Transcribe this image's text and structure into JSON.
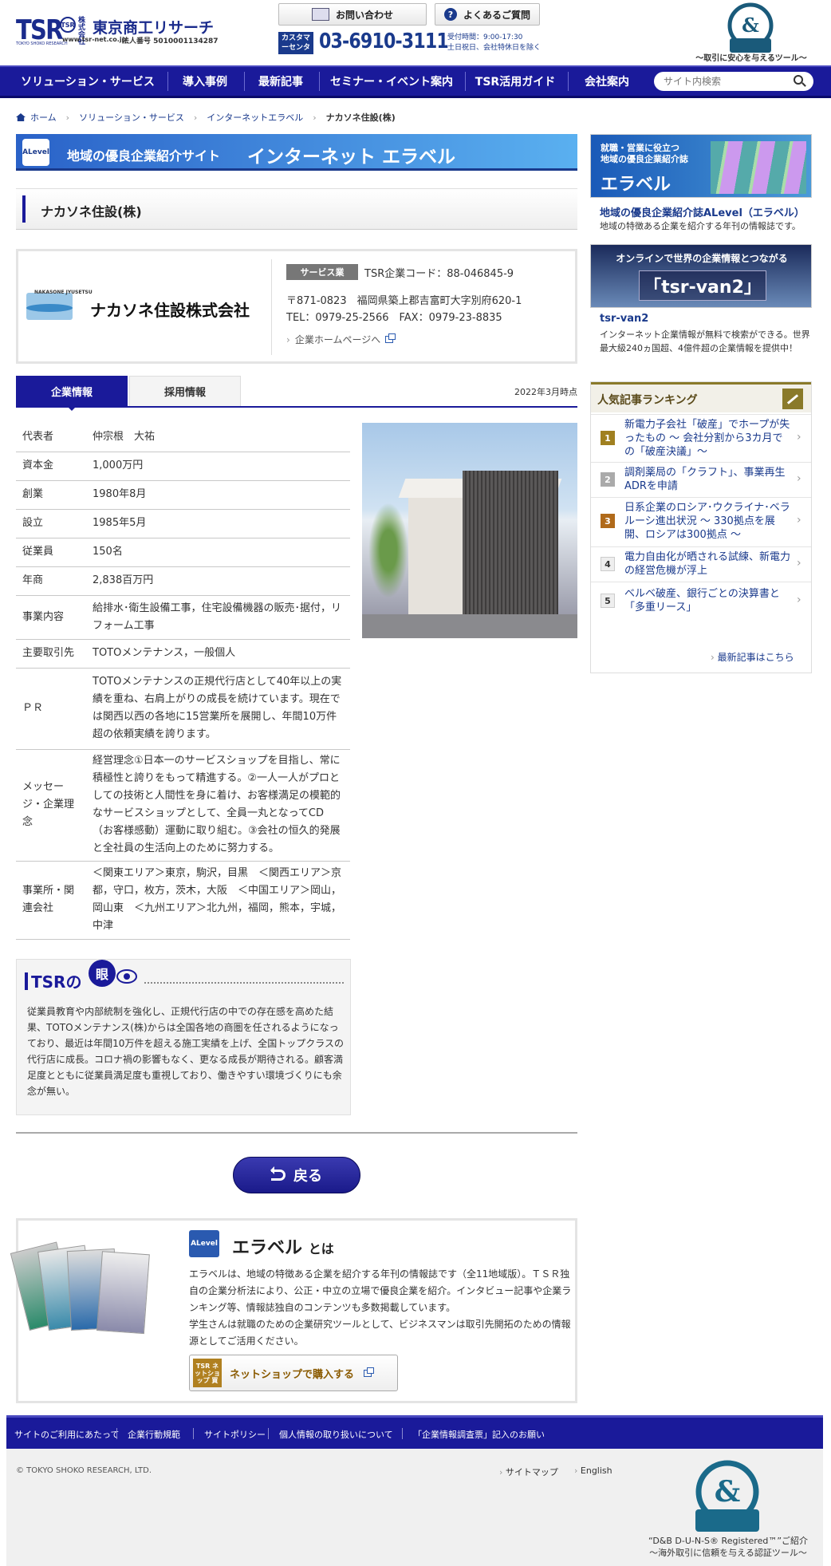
{
  "header": {
    "logo_tsr": "TSR",
    "logo_tsr_sub": "TOKYO SHOKO RESEARCH",
    "logo_mark": "TSR",
    "logo_kabushiki": "株式会社",
    "logo_name": "東京商工リサーチ",
    "logo_url": "www.tsr-net.co.jp",
    "corp_number": "法人番号 5010001134287",
    "contact_label": "お問い合わせ",
    "faq_label": "よくあるご質問",
    "cc_label": "カスタマーセンター",
    "cc_tel": "03-6910-3111",
    "cc_hours": "受付時間：9:00-17:30",
    "cc_closed": "土日祝日、会社特休日を除く",
    "duns_tagline": "〜取引に安心を与えるツール〜"
  },
  "nav": {
    "items": [
      "ソリューション・サービス",
      "導入事例",
      "最新記事",
      "セミナー・イベント案内",
      "TSR活用ガイド",
      "会社案内"
    ],
    "search_placeholder": "サイト内検索"
  },
  "breadcrumb": [
    "ホーム",
    "ソリューション・サービス",
    "インターネットエラベル",
    "ナカソネ住設(株)"
  ],
  "banner": {
    "logo": "ALevel",
    "t1": "地域の優良企業紹介サイト",
    "t2": "インターネット エラベル"
  },
  "company_title": "ナカソネ住設(株)",
  "card": {
    "logo_text": "NAKASONE JYUSETSU",
    "name": "ナカソネ住設株式会社",
    "service": "サービス業",
    "tsr_code": "TSR企業コード：88-046845-9",
    "address": "〒871-0823　福岡県築上郡吉富町大字別府620-1",
    "tel": "TEL：0979-25-2566　FAX：0979-23-8835",
    "homepage": "企業ホームページへ"
  },
  "tabs": {
    "active": "企業情報",
    "other": "採用情報",
    "as_of": "2022年3月時点"
  },
  "info_rows": [
    {
      "k": "代表者",
      "v": "仲宗根　大祐"
    },
    {
      "k": "資本金",
      "v": "1,000万円"
    },
    {
      "k": "創業",
      "v": "1980年8月"
    },
    {
      "k": "設立",
      "v": "1985年5月"
    },
    {
      "k": "従業員",
      "v": "150名"
    },
    {
      "k": "年商",
      "v": "2,838百万円"
    },
    {
      "k": "事業内容",
      "v": "給排水･衛生設備工事，住宅設備機器の販売･据付，リフォーム工事"
    },
    {
      "k": "主要取引先",
      "v": "TOTOメンテナンス，一般個人"
    },
    {
      "k": "ＰＲ",
      "v": "TOTOメンテナンスの正規代行店として40年以上の実績を重ね、右肩上がりの成長を続けています。現在では関西以西の各地に15営業所を展開し、年間10万件超の依頼実績を誇ります。"
    },
    {
      "k": "メッセージ・企業理念",
      "v": "経営理念①日本一のサービスショップを目指し、常に積極性と誇りをもって精進する。②一人一人がプロとしての技術と人間性を身に着け、お客様満足の模範的なサービスショップとして、全員一丸となってCD（お客様感動）運動に取り組む。③会社の恒久的発展と全社員の生活向上のために努力する。"
    },
    {
      "k": "事業所・関連会社",
      "v": "＜関東エリア＞東京，駒沢，目黒　＜関西エリア＞京都，守口，枚方，茨木，大阪　＜中国エリア＞岡山，岡山東　＜九州エリア＞北九州，福岡，熊本，宇城，中津"
    }
  ],
  "eye": {
    "title": "TSRの",
    "circle": "眼",
    "text": "従業員教育や内部統制を強化し、正規代行店の中での存在感を高めた結果、TOTOメンテナンス(株)からは全国各地の商圏を任されるようになっており、最近は年間10万件を超える施工実績を上げ、全国トップクラスの代行店に成長。コロナ禍の影響もなく、更なる成長が期待される。顧客満足度とともに従業員満足度も重視しており、働きやすい環境づくりにも余念が無い。"
  },
  "back_label": "戻る",
  "alevel": {
    "logo": "ALevel",
    "title": "エラベル",
    "title_suffix": "とは",
    "p1": "エラベルは、地域の特徴ある企業を紹介する年刊の情報誌です（全11地域版）。ＴＳＲ独自の企業分析法により、公正・中立の立場で優良企業を紹介。インタビュー記事や企業ランキング等、情報誌独自のコンテンツも多数掲載しています。",
    "p2": "学生さんは就職のための企業研究ツールとして、ビジネスマンは取引先開拓のための情報源としてご活用ください。",
    "shop_icon": "TSR ネットショップ 買",
    "shop_label": "ネットショップで購入する"
  },
  "sidebar": {
    "b1_line1": "就職・営業に役立つ",
    "b1_line2": "地域の優良企業紹介誌",
    "b1_logo": "エラベル",
    "link1": "地域の優良企業紹介誌ALevel（エラベル）",
    "desc1": "地域の特徴ある企業を紹介する年刊の情報誌です。",
    "b2_line": "オンラインで世界の企業情報とつながる",
    "b2_logo": "「tsr-van2」",
    "link2": "tsr-van2",
    "desc2": "インターネット企業情報が無料で検索ができる。世界最大級240ヵ国超、4億件超の企業情報を提供中！"
  },
  "ranking": {
    "title": "人気記事ランキング",
    "items": [
      {
        "n": "1",
        "t": "新電力子会社「破産」でホープが失ったもの 〜 会社分割から3カ月での「破産決議」〜"
      },
      {
        "n": "2",
        "t": "調剤薬局の「クラフト」、事業再生ADRを申請"
      },
      {
        "n": "3",
        "t": "日系企業のロシア･ウクライナ･ベラルーシ進出状況 〜 330拠点を展開、ロシアは300拠点 〜"
      },
      {
        "n": "4",
        "t": "電力自由化が晒される試練、新電力の経営危機が浮上"
      },
      {
        "n": "5",
        "t": "ベルベ破産、銀行ごとの決算書と「多重リース」"
      }
    ],
    "more": "最新記事はこちら"
  },
  "footer": {
    "nav": [
      "サイトのご利用にあたって",
      "企業行動規範",
      "サイトポリシー",
      "個人情報の取り扱いについて",
      "「企業情報調査票」記入のお願い"
    ],
    "copyright": "© TOKYO SHOKO RESEARCH, LTD.",
    "sitemap": "サイトマップ",
    "english": "English",
    "duns_cap1": "“D&B D-U-N-S® Registered™”ご紹介",
    "duns_cap2": "〜海外取引に信頼を与える認証ツール〜"
  },
  "colors": {
    "brand": "#1a1a9a",
    "link": "#1a3a8c",
    "banner": "#2a62c8"
  }
}
